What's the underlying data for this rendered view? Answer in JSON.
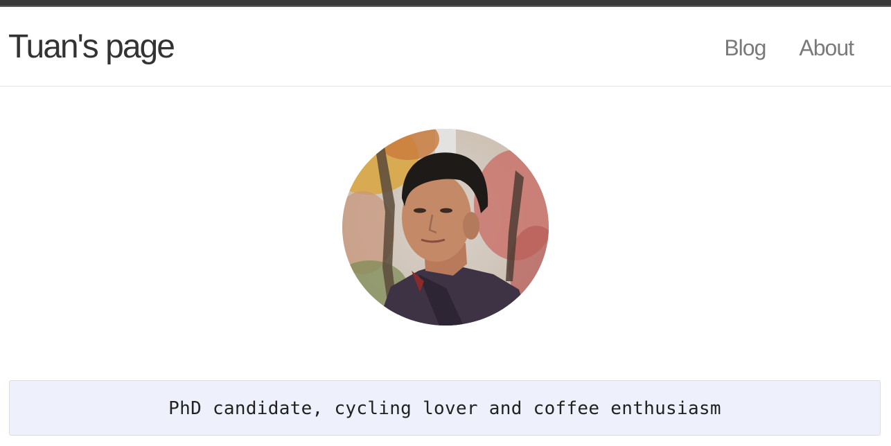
{
  "site": {
    "title": "Tuan's page"
  },
  "nav": {
    "items": [
      {
        "label": "Blog"
      },
      {
        "label": "About"
      }
    ]
  },
  "profile": {
    "tagline": "PhD candidate, cycling lover and coffee enthusiasm"
  },
  "colors": {
    "accent_strip": "#3a3a3a",
    "tagline_background": "#eef0fb",
    "title_text": "#333333",
    "nav_text": "#7a7a7a"
  }
}
